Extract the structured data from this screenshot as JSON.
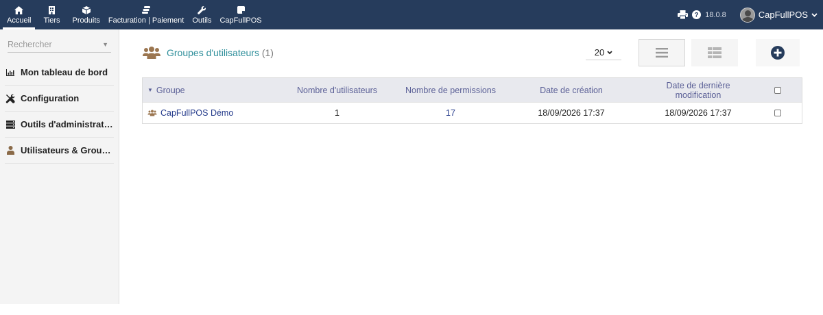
{
  "topbar": {
    "nav": [
      {
        "label": "Accueil",
        "icon": "home-icon"
      },
      {
        "label": "Tiers",
        "icon": "building-icon"
      },
      {
        "label": "Produits",
        "icon": "cube-icon"
      },
      {
        "label": "Facturation | Paiement",
        "icon": "coins-icon"
      },
      {
        "label": "Outils",
        "icon": "wrench-icon"
      },
      {
        "label": "CapFullPOS",
        "icon": "note-icon"
      }
    ],
    "version": "18.0.8",
    "user_name": "CapFullPOS",
    "colors": {
      "background": "#263c5c",
      "text": "#ffffff"
    }
  },
  "sidebar": {
    "search_placeholder": "Rechercher",
    "items": [
      {
        "label": "Mon tableau de bord",
        "icon": "chart-icon"
      },
      {
        "label": "Configuration",
        "icon": "tools-icon"
      },
      {
        "label": "Outils d'administrati…",
        "icon": "server-icon"
      },
      {
        "label": "Utilisateurs & Group…",
        "icon": "user-icon"
      }
    ]
  },
  "main": {
    "title": "Groupes d'utilisateurs",
    "count": "(1)",
    "page_size": "20",
    "table": {
      "headers": [
        "Groupe",
        "Nombre d'utilisateurs",
        "Nombre de permissions",
        "Date de création",
        "Date de dernière modification"
      ],
      "rows": [
        {
          "group": "CapFullPOS Démo",
          "users": "1",
          "permissions": "17",
          "created": "18/09/2026 17:37",
          "modified": "18/09/2026 17:37"
        }
      ]
    },
    "colors": {
      "title": "#2d8e9a",
      "header_text": "#5a5f96",
      "link": "#263c8c",
      "add_button": "#263c5c"
    }
  }
}
